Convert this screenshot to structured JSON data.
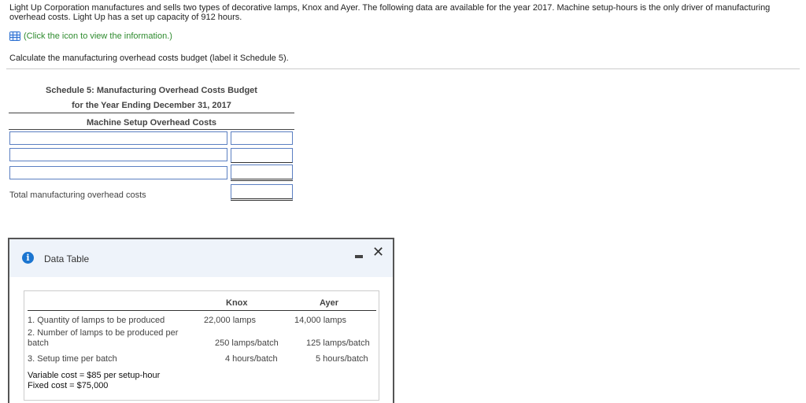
{
  "intro": "Light Up Corporation manufactures and sells two types of decorative lamps, Knox and Ayer. The following data are available for the year 2017. Machine setup-hours is the only driver of manufacturing overhead costs. Light Up has a set up capacity of 912 hours.",
  "info_link": "(Click the icon to view the information.)",
  "instruction": "Calculate the manufacturing overhead costs budget (label it Schedule 5).",
  "schedule": {
    "title": "Schedule 5: Manufacturing Overhead Costs Budget",
    "subtitle": "for the Year Ending December 31, 2017",
    "section": "Machine Setup Overhead Costs",
    "total_label": "Total manufacturing overhead costs"
  },
  "dialog": {
    "title": "Data Table",
    "columns": [
      "Knox",
      "Ayer"
    ],
    "rows": [
      {
        "label": "1. Quantity of lamps to be produced",
        "knox": "22,000 lamps",
        "ayer": "14,000 lamps"
      },
      {
        "label": "2. Number of lamps to be produced per batch",
        "knox": "250 lamps/batch",
        "ayer": "125 lamps/batch"
      },
      {
        "label": "3. Setup time per batch",
        "knox": "4 hours/batch",
        "ayer": "5 hours/batch"
      }
    ],
    "variable_cost": "Variable cost = $85 per setup-hour",
    "fixed_cost": "Fixed cost = $75,000"
  }
}
